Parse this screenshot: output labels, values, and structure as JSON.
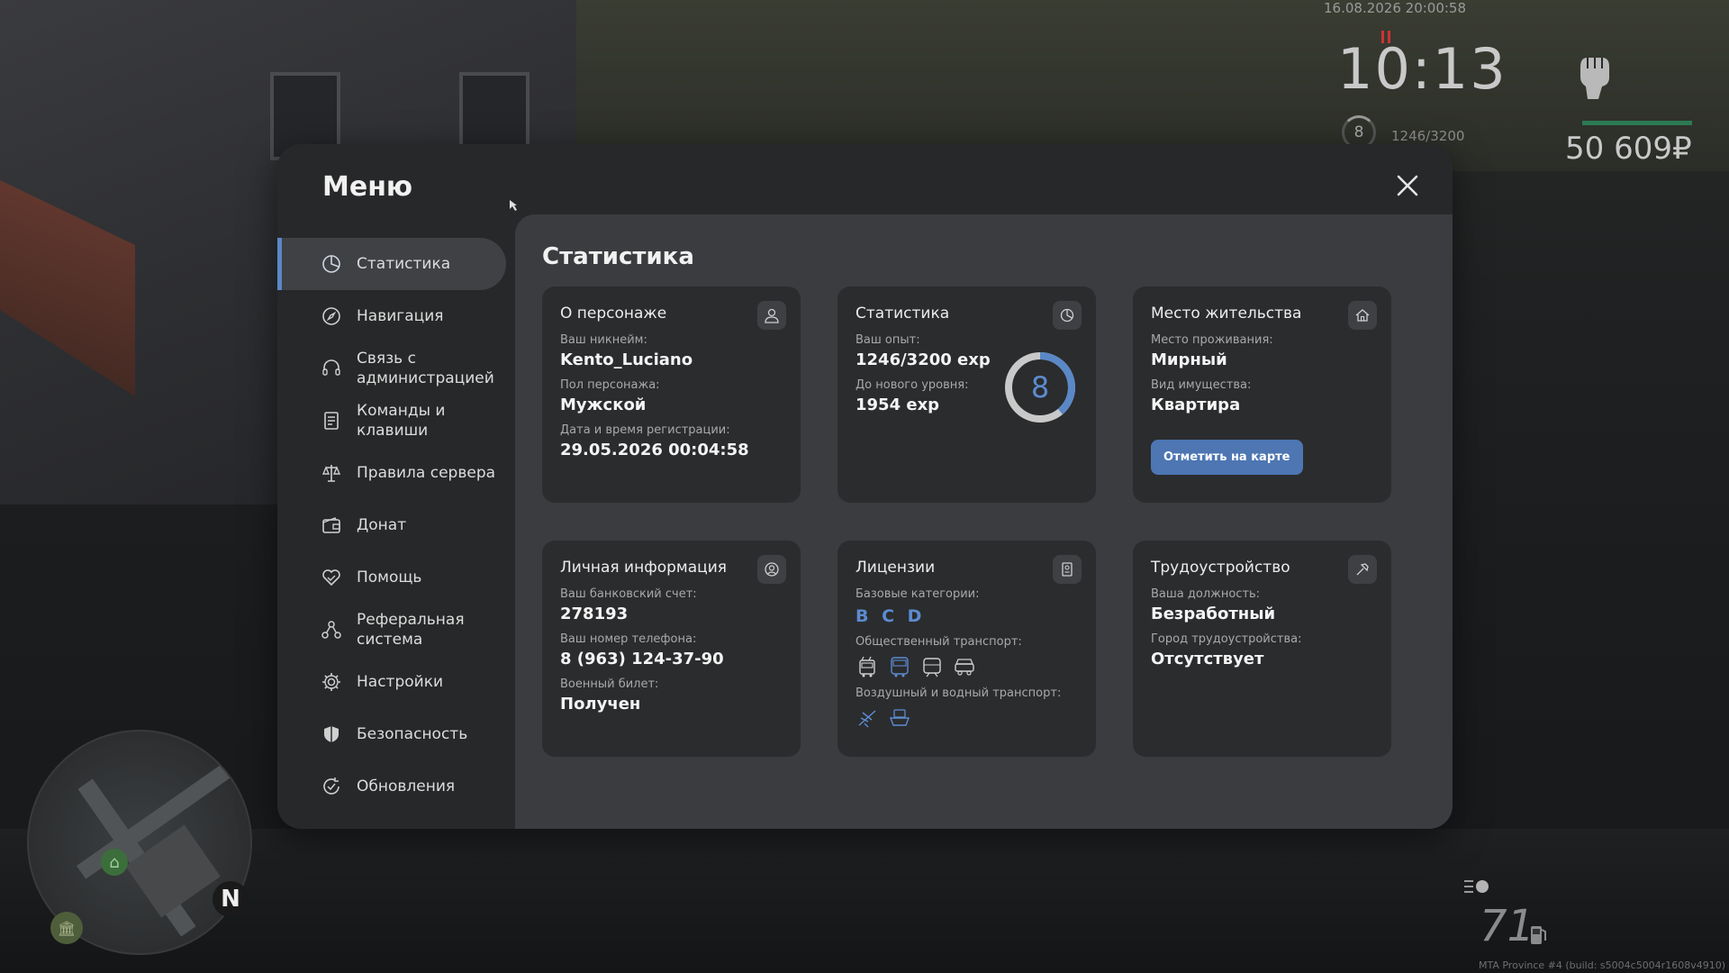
{
  "hud": {
    "date": "16.08.2026 20:00:58",
    "time": "10:13",
    "level": "8",
    "exp": "1246/3200",
    "money": "50 609₽",
    "speed": "71",
    "north": "N",
    "build": "MTA Province #4 (build: s5004c5004r1608v4910)"
  },
  "menu": {
    "title": "Меню",
    "sidebar": [
      {
        "label": "Статистика",
        "icon": "pie-chart-icon",
        "active": true
      },
      {
        "label": "Навигация",
        "icon": "compass-icon"
      },
      {
        "label": "Связь с\nадминистрацией",
        "icon": "headset-icon"
      },
      {
        "label": "Команды и\nклавиши",
        "icon": "document-icon"
      },
      {
        "label": "Правила сервера",
        "icon": "scales-icon"
      },
      {
        "label": "Донат",
        "icon": "wallet-icon"
      },
      {
        "label": "Помощь",
        "icon": "handshake-heart-icon"
      },
      {
        "label": "Реферальная\nсистема",
        "icon": "referral-icon"
      },
      {
        "label": "Настройки",
        "icon": "gear-icon"
      },
      {
        "label": "Безопасность",
        "icon": "shield-icon"
      },
      {
        "label": "Обновления",
        "icon": "update-icon"
      }
    ]
  },
  "content": {
    "title": "Статистика",
    "character": {
      "title": "О персонаже",
      "nickname_label": "Ваш никнейм:",
      "nickname": "Kento_Luciano",
      "gender_label": "Пол персонажа:",
      "gender": "Мужской",
      "reg_label": "Дата и время регистрации:",
      "reg": "29.05.2026 00:04:58"
    },
    "stats": {
      "title": "Статистика",
      "exp_label": "Ваш опыт:",
      "exp": "1246/3200 exp",
      "next_label": "До нового уровня:",
      "next": "1954 exp",
      "level": "8",
      "progress": 0.389
    },
    "residence": {
      "title": "Место жительства",
      "place_label": "Место проживания:",
      "place": "Мирный",
      "property_label": "Вид имущества:",
      "property": "Квартира",
      "map_button": "Отметить на карте"
    },
    "personal": {
      "title": "Личная информация",
      "bank_label": "Ваш банковский счет:",
      "bank": "278193",
      "phone_label": "Ваш номер телефона:",
      "phone": "8 (963) 124-37-90",
      "military_label": "Военный билет:",
      "military": "Получен"
    },
    "licenses": {
      "title": "Лицензии",
      "base_label": "Базовые категории:",
      "base": "B C D",
      "public_label": "Общественный транспорт:",
      "public_icons": [
        "trolleybus-icon",
        "bus-icon",
        "tram-icon",
        "taxi-icon"
      ],
      "air_label": "Воздушный и водный транспорт:",
      "air_icons": [
        "airplane-icon",
        "boat-icon"
      ]
    },
    "job": {
      "title": "Трудоустройство",
      "position_label": "Ваша должность:",
      "position": "Безработный",
      "city_label": "Город трудоустройства:",
      "city": "Отсутствует"
    }
  },
  "colors": {
    "accent": "#5a88c7",
    "button": "#4d76b3",
    "panel": "#272829",
    "content": "#3a3c3f",
    "card": "#2b2c2e"
  }
}
